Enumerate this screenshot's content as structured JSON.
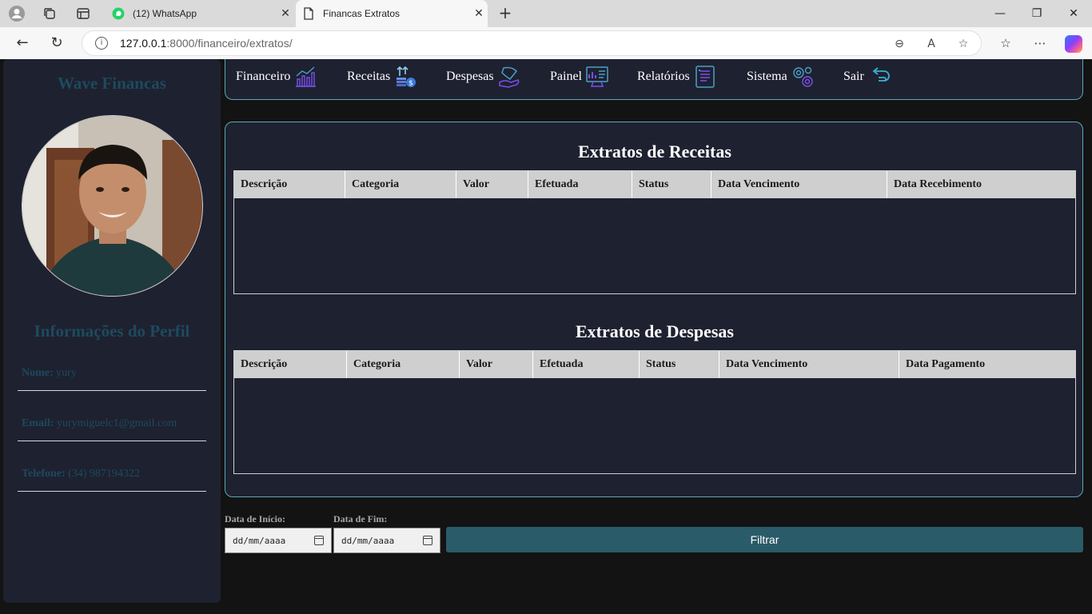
{
  "browser": {
    "tabs": [
      {
        "title": "(12) WhatsApp",
        "icon": "whatsapp-icon",
        "active": false
      },
      {
        "title": "Financas Extratos",
        "icon": "page-icon",
        "active": true
      }
    ],
    "url": {
      "host": "127.0.0.1",
      "path": ":8000/financeiro/extratos/"
    }
  },
  "sidebar": {
    "brand": "Wave Financas",
    "profile_title": "Informações do Perfil",
    "fields": [
      {
        "label": "Nome:",
        "value": "yury"
      },
      {
        "label": "Email:",
        "value": "yurymiguelc1@gmail.com"
      },
      {
        "label": "Telefone:",
        "value": "(34) 987194322"
      }
    ]
  },
  "nav": {
    "items": [
      {
        "label": "Financeiro",
        "icon": "chart-icon"
      },
      {
        "label": "Receitas",
        "icon": "income-icon"
      },
      {
        "label": "Despesas",
        "icon": "expense-icon"
      },
      {
        "label": "Painel",
        "icon": "dashboard-icon"
      },
      {
        "label": "Relatórios",
        "icon": "report-icon"
      },
      {
        "label": "Sistema",
        "icon": "gears-icon"
      },
      {
        "label": "Sair",
        "icon": "logout-icon"
      }
    ]
  },
  "receitas": {
    "title": "Extratos de Receitas",
    "columns": [
      "Descrição",
      "Categoria",
      "Valor",
      "Efetuada",
      "Status",
      "Data Vencimento",
      "Data Recebimento"
    ]
  },
  "despesas": {
    "title": "Extratos de Despesas",
    "columns": [
      "Descrição",
      "Categoria",
      "Valor",
      "Efetuada",
      "Status",
      "Data Vencimento",
      "Data Pagamento"
    ]
  },
  "filter": {
    "start_label": "Data de Início:",
    "end_label": "Data de Fim:",
    "date_placeholder": "dd/mm/aaaa",
    "button": "Filtrar"
  },
  "colors": {
    "accent": "#2a5b68",
    "panel": "#1e2130",
    "border": "#5aa8b8",
    "brand_text": "#1d4a5e"
  }
}
